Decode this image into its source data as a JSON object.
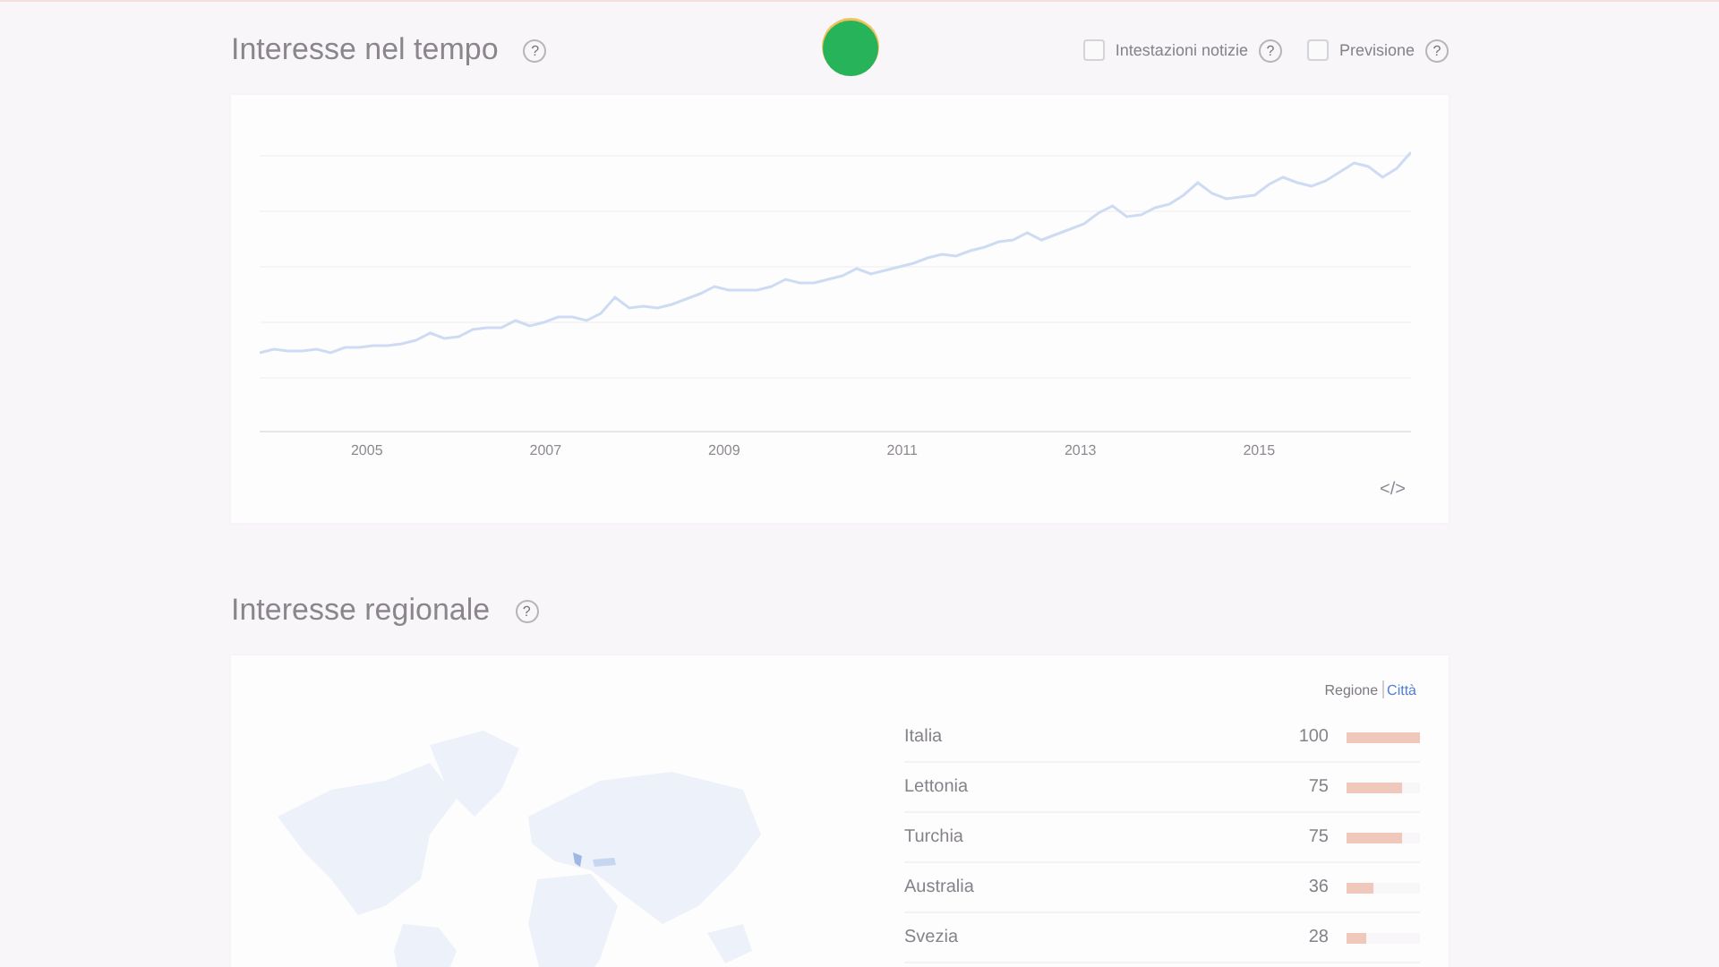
{
  "interest_over_time": {
    "title": "Interesse nel tempo",
    "help": "?",
    "options": [
      {
        "label": "Intestazioni notizie",
        "checked": false,
        "help": "?"
      },
      {
        "label": "Previsione",
        "checked": false,
        "help": "?"
      }
    ],
    "x_labels": [
      "2005",
      "2007",
      "2009",
      "2011",
      "2013",
      "2015"
    ],
    "embed": "</>"
  },
  "regional_interest": {
    "title": "Interesse regionale",
    "help": "?",
    "toggle": [
      {
        "label": "Regione",
        "selected": true
      },
      {
        "label": "Città",
        "selected": false
      }
    ],
    "rows": [
      {
        "name": "Italia",
        "value": "100",
        "level": 1
      },
      {
        "name": "Lettonia",
        "value": "75",
        "level": 0.75
      },
      {
        "name": "Turchia",
        "value": "75",
        "level": 0.75
      },
      {
        "name": "Australia",
        "value": "36",
        "level": 0.36
      },
      {
        "name": "Svezia",
        "value": "28",
        "level": 0.28
      }
    ]
  }
}
